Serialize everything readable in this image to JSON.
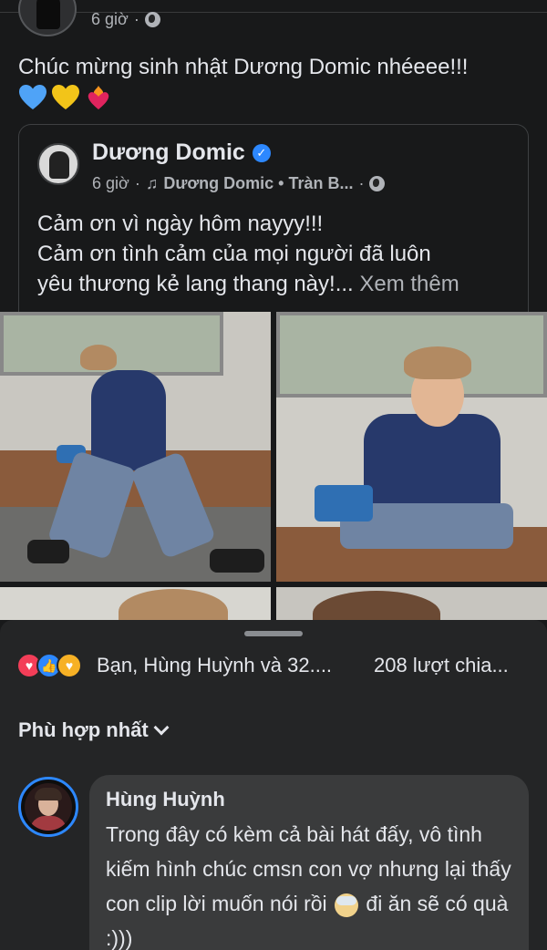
{
  "post": {
    "time": "6 giờ",
    "separator": "·",
    "text": "Chúc mừng sinh nhật Dương Domic nhéeee!!!"
  },
  "shared": {
    "author": "Dương Domic",
    "time": "6 giờ",
    "separator": "·",
    "music": "Dương Domic • Tràn B...",
    "line1": "Cảm ơn vì ngày hôm nayyy!!!",
    "line2": "Cảm ơn tình cảm của mọi người đã luôn",
    "line3": "yêu thương kẻ lang thang này!...",
    "see_more": "Xem thêm"
  },
  "reactions": {
    "summary": "Bạn, Hùng Huỳnh và 32....",
    "shares": "208 lượt chia..."
  },
  "sort": {
    "label": "Phù hợp nhất"
  },
  "comment": {
    "author": "Hùng Huỳnh",
    "text_part1": "Trong đây có kèm cả bài hát đấy, vô tình kiếm hình chúc cmsn con vợ nhưng lại thấy con clip lời muốn nói rồi",
    "text_part2": "đi ăn sẽ có quà :)))"
  },
  "colors": {
    "background": "#18191a",
    "sheet": "#242526",
    "bubble": "#3a3b3c",
    "accent_blue": "#2d88ff",
    "text_primary": "#e4e6eb",
    "text_secondary": "#b0b3b8"
  },
  "icons": [
    "globe-icon",
    "verified-badge-icon",
    "music-note-icon",
    "love-reaction-icon",
    "like-reaction-icon",
    "care-reaction-icon",
    "chevron-down-icon",
    "blue-heart-emoji",
    "yellow-heart-emoji",
    "heart-on-fire-emoji",
    "cold-face-emoji"
  ]
}
